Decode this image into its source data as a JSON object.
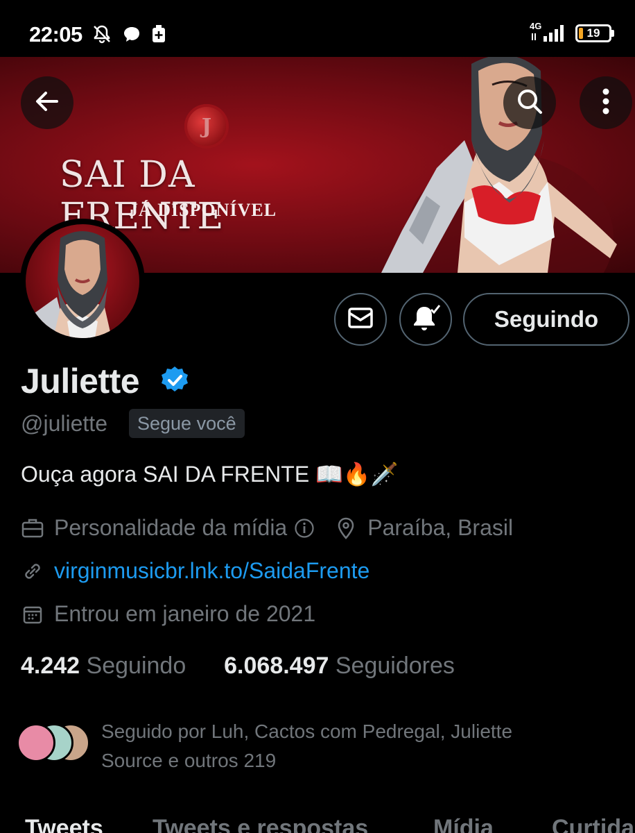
{
  "status_bar": {
    "time": "22:05",
    "network": "4G",
    "battery": "19"
  },
  "banner": {
    "title": "SAI DA FRENTE",
    "subtitle": "JÁ DISPONÍVEL",
    "seal_letter": "J",
    "back_icon": "arrow-left-icon",
    "search_icon": "search-icon",
    "more_icon": "more-vertical-icon"
  },
  "actions": {
    "message_icon": "envelope-icon",
    "notify_icon": "bell-check-icon",
    "follow_label": "Seguindo"
  },
  "profile": {
    "name": "Juliette",
    "handle": "@juliette",
    "follows_you": "Segue você",
    "bio": "Ouça agora SAI DA FRENTE 📖🔥🗡️",
    "category": "Personalidade da mídia",
    "location": "Paraíba, Brasil",
    "link": "virginmusicbr.lnk.to/SaidaFrente",
    "joined": "Entrou em janeiro de 2021",
    "following_count": "4.242",
    "following_label": "Seguindo",
    "followers_count": "6.068.497",
    "followers_label": "Seguidores",
    "followed_by_line1": "Seguido por Luh, Cactos com Pedregal, Juliette",
    "followed_by_line2": "Source e outros 219"
  },
  "tabs": [
    {
      "label": "Tweets",
      "active": true
    },
    {
      "label": "Tweets e respostas",
      "active": false
    },
    {
      "label": "Mídia",
      "active": false
    },
    {
      "label": "Curtidas",
      "active": false
    }
  ],
  "colors": {
    "accent": "#1d9bf0",
    "muted": "#71767b",
    "banner_red": "#a3121c"
  }
}
